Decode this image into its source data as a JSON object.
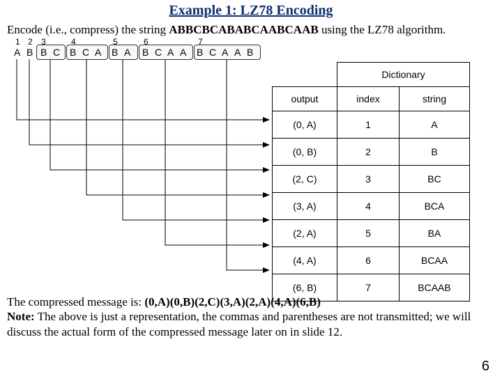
{
  "title": "Example 1: LZ78 Encoding",
  "prompt_pre": "Encode (i.e., compress) the string ",
  "prompt_bold": "ABBCBCABABCAABCAAB",
  "prompt_post": " using the LZ78 algorithm.",
  "seq_indices": [
    "1",
    "2",
    "3",
    "4",
    "5",
    "6",
    "7"
  ],
  "seq_letters": [
    "A",
    "B",
    "B",
    "C",
    "B",
    "C",
    "A",
    "B",
    "A",
    "B",
    "C",
    "A",
    "A",
    "B",
    "C",
    "A",
    "A",
    "B"
  ],
  "dict_super": "Dictionary",
  "dict_headers": {
    "output": "output",
    "index": "index",
    "string": "string"
  },
  "rows": [
    {
      "output": "(0, A)",
      "index": "1",
      "string": "A"
    },
    {
      "output": "(0, B)",
      "index": "2",
      "string": "B"
    },
    {
      "output": "(2, C)",
      "index": "3",
      "string": "BC"
    },
    {
      "output": "(3, A)",
      "index": "4",
      "string": "BCA"
    },
    {
      "output": "(2, A)",
      "index": "5",
      "string": "BA"
    },
    {
      "output": "(4, A)",
      "index": "6",
      "string": "BCAA"
    },
    {
      "output": "(6, B)",
      "index": "7",
      "string": "BCAAB"
    }
  ],
  "msg_pre": "The compressed message is: ",
  "msg_bold": "(0,A)(0,B)(2,C)(3,A)(2,A)(4,A)(6,B)",
  "note_label": "Note:",
  "note_body": " The above is just a representation, the commas and parentheses are not transmitted; we will discuss the actual form of the compressed message later on in slide 12.",
  "page": "6"
}
